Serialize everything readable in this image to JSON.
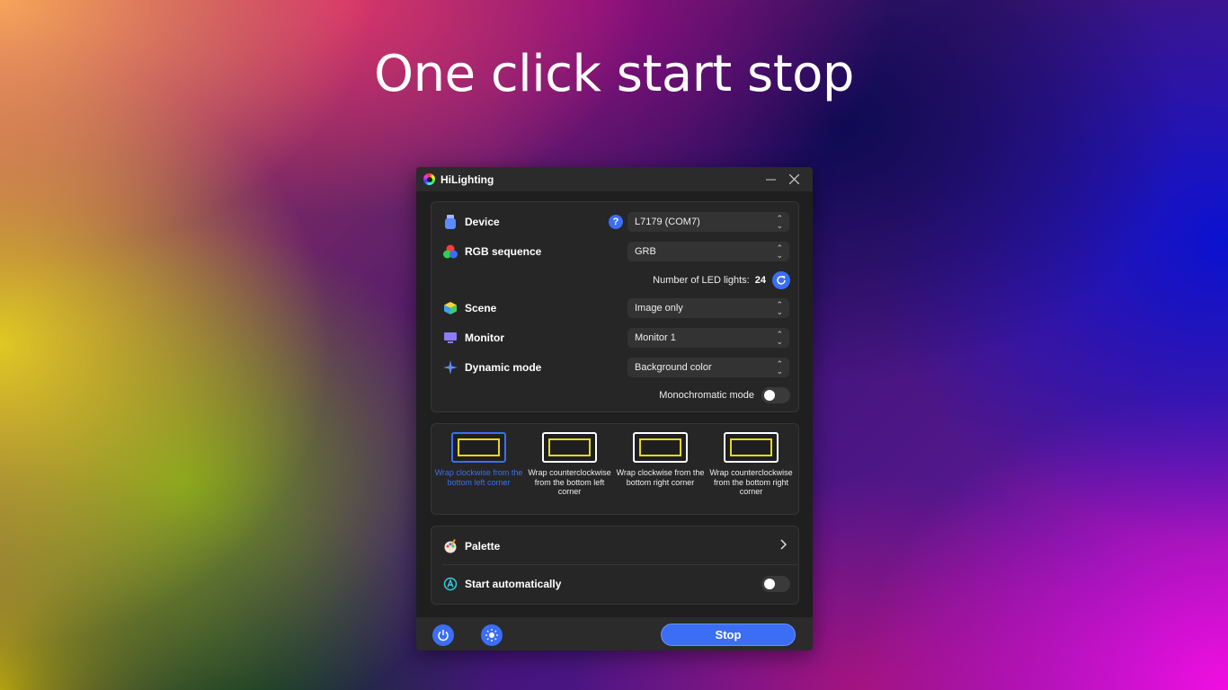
{
  "headline": "One click start stop",
  "window": {
    "title": "HiLighting"
  },
  "settings": {
    "device": {
      "label": "Device",
      "value": "L7179 (COM7)",
      "help": "?"
    },
    "rgb_sequence": {
      "label": "RGB sequence",
      "value": "GRB"
    },
    "led_count": {
      "label": "Number of LED lights:",
      "value": "24"
    },
    "scene": {
      "label": "Scene",
      "value": "Image only"
    },
    "monitor": {
      "label": "Monitor",
      "value": "Monitor 1"
    },
    "dynamic_mode": {
      "label": "Dynamic mode",
      "value": "Background color"
    },
    "monochromatic": {
      "label": "Monochromatic mode",
      "enabled": false
    }
  },
  "wrap_options": [
    {
      "label": "Wrap clockwise from the bottom left corner",
      "selected": true
    },
    {
      "label": "Wrap counterclockwise from the bottom left corner",
      "selected": false
    },
    {
      "label": "Wrap clockwise from the bottom right corner",
      "selected": false
    },
    {
      "label": "Wrap counterclockwise from the bottom right corner",
      "selected": false
    }
  ],
  "palette": {
    "label": "Palette"
  },
  "start_auto": {
    "label": "Start automatically",
    "enabled": false
  },
  "footer": {
    "stop_label": "Stop"
  },
  "colors": {
    "accent": "#3b6ef5",
    "panel": "#1f1f1f",
    "led_frame": "#e6d820"
  }
}
